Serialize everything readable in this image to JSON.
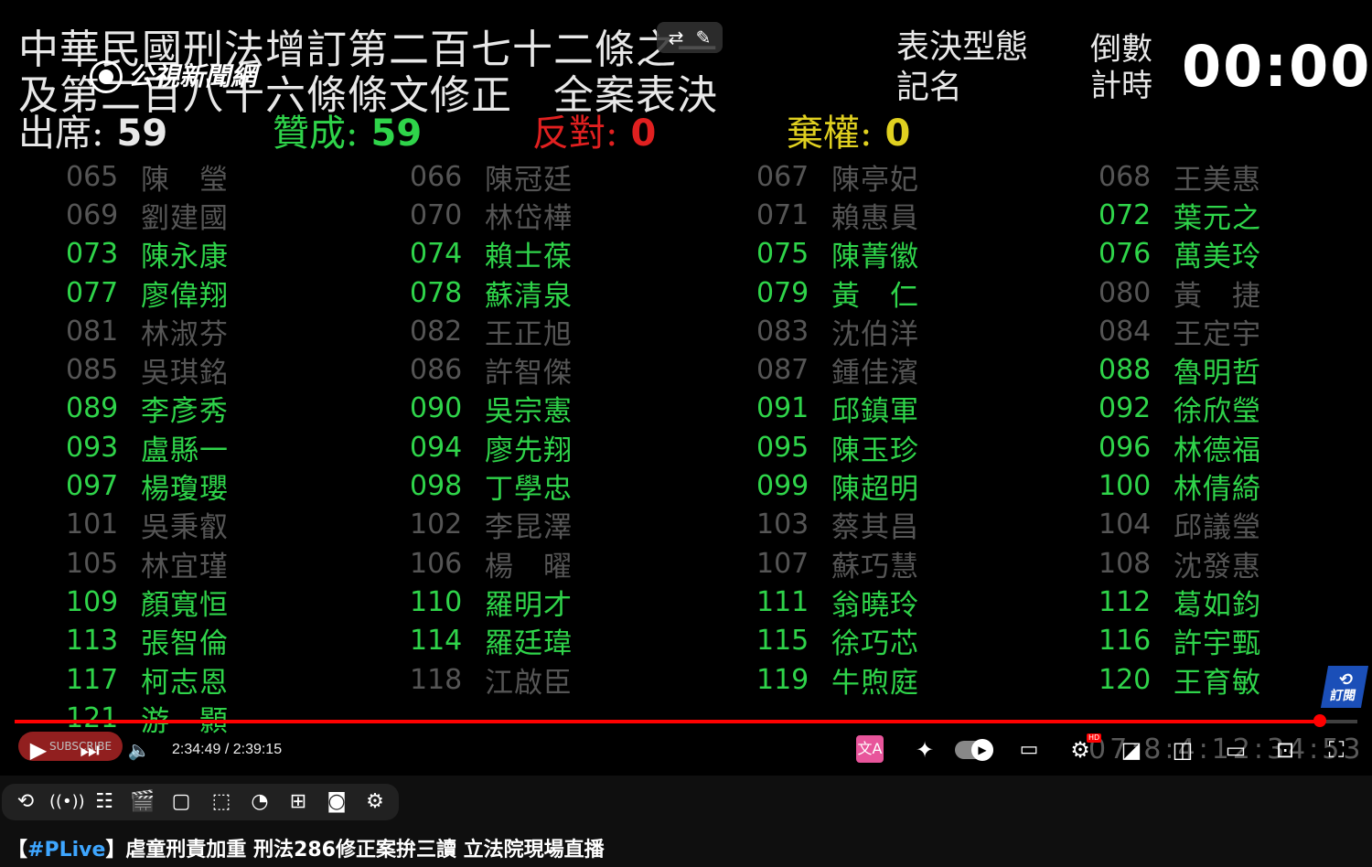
{
  "board": {
    "title_line1": "中華民國刑法增訂第二百七十二條之一",
    "title_line2": "及第二百八十六條條文修正　全案表決",
    "vote_type_label": "表決型態",
    "vote_type_value": "記名",
    "countdown_label_1": "倒數",
    "countdown_label_2": "計時",
    "countdown_value": "00:00",
    "channel_logo": "公視新聞網",
    "stats": {
      "present_label": "出席:",
      "present_value": "59",
      "yes_label": "贊成:",
      "yes_value": "59",
      "no_label": "反對:",
      "no_value": "0",
      "abstain_label": "棄權:",
      "abstain_value": "0"
    },
    "colors": {
      "yes": "#2fd44a",
      "absent": "#555555",
      "no": "#e02020",
      "abstain": "#e0d020",
      "present": "#e8e8e8"
    },
    "roster_columns": [
      [
        {
          "no": "065",
          "name": "陳　瑩",
          "status": "absent"
        },
        {
          "no": "069",
          "name": "劉建國",
          "status": "absent"
        },
        {
          "no": "073",
          "name": "陳永康",
          "status": "yes"
        },
        {
          "no": "077",
          "name": "廖偉翔",
          "status": "yes"
        },
        {
          "no": "081",
          "name": "林淑芬",
          "status": "absent"
        },
        {
          "no": "085",
          "name": "吳琪銘",
          "status": "absent"
        },
        {
          "no": "089",
          "name": "李彥秀",
          "status": "yes"
        },
        {
          "no": "093",
          "name": "盧縣一",
          "status": "yes"
        },
        {
          "no": "097",
          "name": "楊瓊瓔",
          "status": "yes"
        },
        {
          "no": "101",
          "name": "吳秉叡",
          "status": "absent"
        },
        {
          "no": "105",
          "name": "林宜瑾",
          "status": "absent"
        },
        {
          "no": "109",
          "name": "顏寬恒",
          "status": "yes"
        },
        {
          "no": "113",
          "name": "張智倫",
          "status": "yes"
        },
        {
          "no": "117",
          "name": "柯志恩",
          "status": "yes"
        },
        {
          "no": "121",
          "name": "游　顥",
          "status": "yes"
        }
      ],
      [
        {
          "no": "066",
          "name": "陳冠廷",
          "status": "absent"
        },
        {
          "no": "070",
          "name": "林岱樺",
          "status": "absent"
        },
        {
          "no": "074",
          "name": "賴士葆",
          "status": "yes"
        },
        {
          "no": "078",
          "name": "蘇清泉",
          "status": "yes"
        },
        {
          "no": "082",
          "name": "王正旭",
          "status": "absent"
        },
        {
          "no": "086",
          "name": "許智傑",
          "status": "absent"
        },
        {
          "no": "090",
          "name": "吳宗憲",
          "status": "yes"
        },
        {
          "no": "094",
          "name": "廖先翔",
          "status": "yes"
        },
        {
          "no": "098",
          "name": "丁學忠",
          "status": "yes"
        },
        {
          "no": "102",
          "name": "李昆澤",
          "status": "absent"
        },
        {
          "no": "106",
          "name": "楊　曜",
          "status": "absent"
        },
        {
          "no": "110",
          "name": "羅明才",
          "status": "yes"
        },
        {
          "no": "114",
          "name": "羅廷瑋",
          "status": "yes"
        },
        {
          "no": "118",
          "name": "江啟臣",
          "status": "absent"
        }
      ],
      [
        {
          "no": "067",
          "name": "陳亭妃",
          "status": "absent"
        },
        {
          "no": "071",
          "name": "賴惠員",
          "status": "absent"
        },
        {
          "no": "075",
          "name": "陳菁徽",
          "status": "yes"
        },
        {
          "no": "079",
          "name": "黃　仁",
          "status": "yes"
        },
        {
          "no": "083",
          "name": "沈伯洋",
          "status": "absent"
        },
        {
          "no": "087",
          "name": "鍾佳濱",
          "status": "absent"
        },
        {
          "no": "091",
          "name": "邱鎮軍",
          "status": "yes"
        },
        {
          "no": "095",
          "name": "陳玉珍",
          "status": "yes"
        },
        {
          "no": "099",
          "name": "陳超明",
          "status": "yes"
        },
        {
          "no": "103",
          "name": "蔡其昌",
          "status": "absent"
        },
        {
          "no": "107",
          "name": "蘇巧慧",
          "status": "absent"
        },
        {
          "no": "111",
          "name": "翁曉玲",
          "status": "yes"
        },
        {
          "no": "115",
          "name": "徐巧芯",
          "status": "yes"
        },
        {
          "no": "119",
          "name": "牛煦庭",
          "status": "yes"
        }
      ],
      [
        {
          "no": "068",
          "name": "王美惠",
          "status": "absent"
        },
        {
          "no": "072",
          "name": "葉元之",
          "status": "yes"
        },
        {
          "no": "076",
          "name": "萬美玲",
          "status": "yes"
        },
        {
          "no": "080",
          "name": "黃　捷",
          "status": "absent"
        },
        {
          "no": "084",
          "name": "王定宇",
          "status": "absent"
        },
        {
          "no": "088",
          "name": "魯明哲",
          "status": "yes"
        },
        {
          "no": "092",
          "name": "徐欣瑩",
          "status": "yes"
        },
        {
          "no": "096",
          "name": "林德福",
          "status": "yes"
        },
        {
          "no": "100",
          "name": "林倩綺",
          "status": "yes"
        },
        {
          "no": "104",
          "name": "邱議瑩",
          "status": "absent"
        },
        {
          "no": "108",
          "name": "沈發惠",
          "status": "absent"
        },
        {
          "no": "112",
          "name": "葛如鈞",
          "status": "yes"
        },
        {
          "no": "116",
          "name": "許宇甄",
          "status": "yes"
        },
        {
          "no": "120",
          "name": "王育敏",
          "status": "yes"
        }
      ]
    ]
  },
  "player": {
    "current_time": "2:34:49",
    "duration": "2:39:15",
    "time_display": "2:34:49 / 2:39:15",
    "progress_fraction": 0.9721,
    "subscribe_pill_label": "SUBSCRIBE",
    "corner_subscribe_label": "訂閱",
    "ghost_clock": "07:8:4:12:34:53",
    "hd_badge": "HD",
    "icons": {
      "play": "play-icon",
      "next": "next-icon",
      "volume": "volume-icon",
      "translate": "translate-icon",
      "sparkle": "sparkle-icon",
      "autoplay": "autoplay-toggle",
      "captions": "captions-icon",
      "settings": "settings-gear-icon",
      "miniplayer": "miniplayer-icon",
      "theater": "theater-mode-icon",
      "cast": "cast-icon",
      "fullscreen": "fullscreen-icon"
    }
  },
  "extension_bar": {
    "icons": [
      "loop-icon",
      "live-signal-icon",
      "view-tracker-icon",
      "clapper-icon",
      "aspect-ratio-icon",
      "dotted-frame-icon",
      "speed-gauge-icon",
      "sparkle-frame-icon",
      "camera-icon",
      "gear-icon"
    ]
  },
  "video": {
    "title_prefix": "【",
    "title_tag": "#PLive",
    "title_text": "】虐童刑責加重 刑法286修正案拚三讀 立法院現場直播"
  }
}
